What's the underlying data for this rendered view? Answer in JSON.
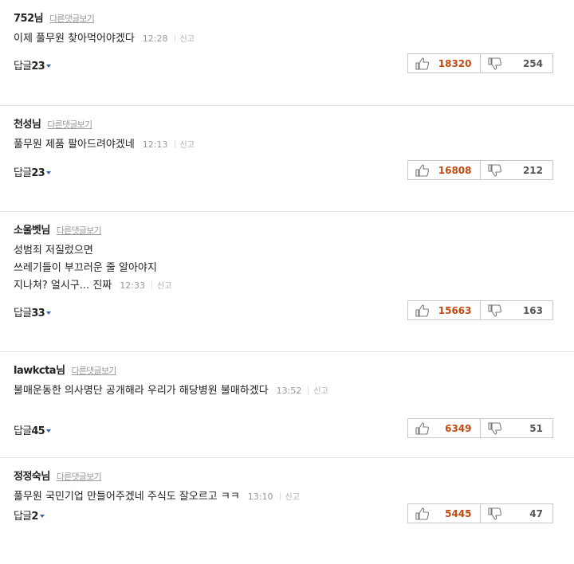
{
  "labels": {
    "view_other": "다른댓글보기",
    "report": "신고",
    "reply_prefix": "답글"
  },
  "colors": {
    "like_count": "#c24a0f",
    "dislike_count": "#555555",
    "reply_caret": "#3a60b4"
  },
  "comments": [
    {
      "author": "752님",
      "lines": [
        "이제 풀무원 찾아먹어야겠다"
      ],
      "time": "12:28",
      "reply_count": "23",
      "likes": "18320",
      "dislikes": "254"
    },
    {
      "author": "천성님",
      "lines": [
        "풀무원 제품 팔아드려야겠네"
      ],
      "time": "12:13",
      "reply_count": "23",
      "likes": "16808",
      "dislikes": "212"
    },
    {
      "author": "소울벳님",
      "lines": [
        "성범죄 저질렀으면",
        "쓰레기들이 부끄러운 줄 알아야지",
        "지나쳐? 얼시구... 진짜"
      ],
      "time": "12:33",
      "reply_count": "33",
      "likes": "15663",
      "dislikes": "163"
    },
    {
      "author": "lawkcta님",
      "lines": [
        "불매운동한 의사명단 공개해라 우리가 해당병원 불매하겠다"
      ],
      "time": "13:52",
      "reply_count": "45",
      "likes": "6349",
      "dislikes": "51"
    },
    {
      "author": "정정숙님",
      "lines": [
        "풀무원 국민기업 만들어주겠네 주식도 잘오르고 ㅋㅋ"
      ],
      "time": "13:10",
      "reply_count": "2",
      "likes": "5445",
      "dislikes": "47"
    }
  ]
}
